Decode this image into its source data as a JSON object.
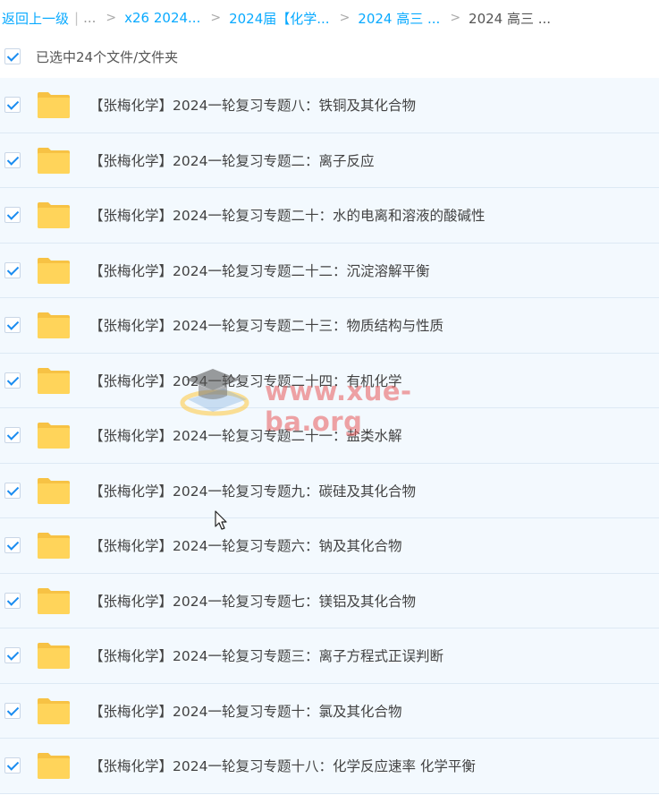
{
  "breadcrumb": {
    "back_label": "返回上一级",
    "pipe": "|",
    "ellipsis": "...",
    "separator": ">",
    "items": [
      "x26 2024...",
      "2024届【化学...",
      "2024 高三 ...",
      "2024 高三 ..."
    ]
  },
  "selection": {
    "label": "已选中24个文件/文件夹",
    "checked": true
  },
  "files": [
    {
      "name": "【张梅化学】2024一轮复习专题八：铁铜及其化合物",
      "checked": true,
      "icon": "folder-icon"
    },
    {
      "name": "【张梅化学】2024一轮复习专题二：离子反应",
      "checked": true,
      "icon": "folder-icon"
    },
    {
      "name": "【张梅化学】2024一轮复习专题二十：水的电离和溶液的酸碱性",
      "checked": true,
      "icon": "folder-icon"
    },
    {
      "name": "【张梅化学】2024一轮复习专题二十二：沉淀溶解平衡",
      "checked": true,
      "icon": "folder-icon"
    },
    {
      "name": "【张梅化学】2024一轮复习专题二十三：物质结构与性质",
      "checked": true,
      "icon": "folder-icon"
    },
    {
      "name": "【张梅化学】2024一轮复习专题二十四：有机化学",
      "checked": true,
      "icon": "folder-icon"
    },
    {
      "name": "【张梅化学】2024一轮复习专题二十一：盐类水解",
      "checked": true,
      "icon": "folder-icon"
    },
    {
      "name": "【张梅化学】2024一轮复习专题九：碳硅及其化合物",
      "checked": true,
      "icon": "folder-icon"
    },
    {
      "name": "【张梅化学】2024一轮复习专题六：钠及其化合物",
      "checked": true,
      "icon": "folder-icon"
    },
    {
      "name": "【张梅化学】2024一轮复习专题七：镁铝及其化合物",
      "checked": true,
      "icon": "folder-icon"
    },
    {
      "name": "【张梅化学】2024一轮复习专题三：离子方程式正误判断",
      "checked": true,
      "icon": "folder-icon"
    },
    {
      "name": "【张梅化学】2024一轮复习专题十：氯及其化合物",
      "checked": true,
      "icon": "folder-icon"
    },
    {
      "name": "【张梅化学】2024一轮复习专题十八：化学反应速率 化学平衡",
      "checked": true,
      "icon": "folder-icon"
    }
  ],
  "watermark": {
    "text": "www.xue-ba.org"
  },
  "colors": {
    "link": "#09aaff",
    "check": "#1a8cf0",
    "row_bg": "#f3f9fe",
    "folder": "#ffd258"
  }
}
